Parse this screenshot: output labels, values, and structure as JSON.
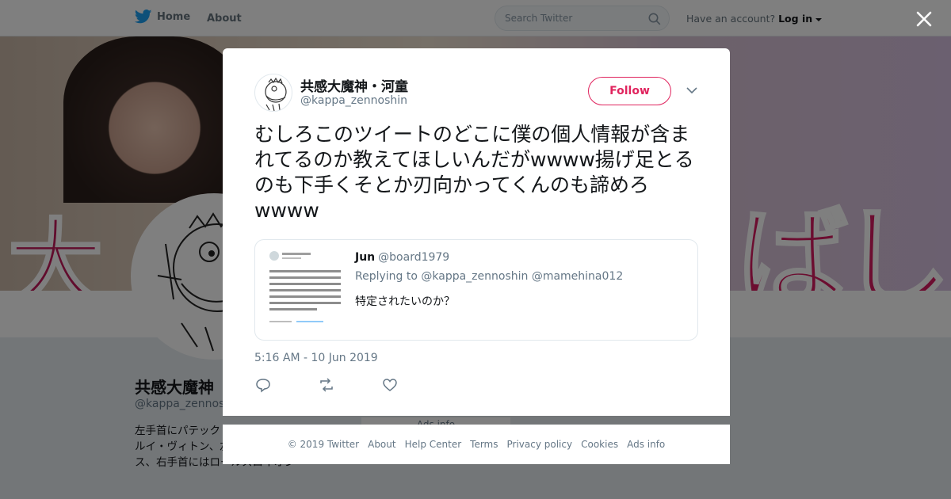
{
  "nav": {
    "home_label": "Home",
    "about_label": "About",
    "search_placeholder": "Search Twitter",
    "account_prompt": "Have an account?",
    "login_label": "Log in"
  },
  "profile": {
    "name": "共感大魔神",
    "handle": "@kappa_zennoshin",
    "bio": "左手首にパテック フィリップ、右手首にルイ・ヴィトン、左手首にロールス・ロイス、右手首にはロールスロイオン",
    "ads_info_peek": "Ads info"
  },
  "tweet": {
    "author_name": "共感大魔神・河童",
    "author_handle": "@kappa_zennoshin",
    "follow_label": "Follow",
    "text": "むしろこのツイートのどこに僕の個人情報が含まれてるのか教えてほしいんだがwwww揚げ足とるのも下手くそとか刃向かってくんのも諦めろwwww",
    "timestamp": "5:16 AM - 10 Jun 2019",
    "quoted": {
      "name": "Jun",
      "handle": "@board1979",
      "replying_to": "Replying to @kappa_zennoshin @mamehina012",
      "text": "特定されたいのか？"
    }
  },
  "footer": {
    "links": [
      "© 2019 Twitter",
      "About",
      "Help Center",
      "Terms",
      "Privacy policy",
      "Cookies",
      "Ads info"
    ]
  },
  "colors": {
    "twitter_blue": "#1da1f2",
    "follow_accent": "#e0245e",
    "muted_text": "#657786"
  },
  "icons": [
    "twitter-bird-icon",
    "search-icon",
    "caret-down-icon",
    "close-icon",
    "chevron-down-icon",
    "reply-icon",
    "retweet-icon",
    "like-icon"
  ]
}
